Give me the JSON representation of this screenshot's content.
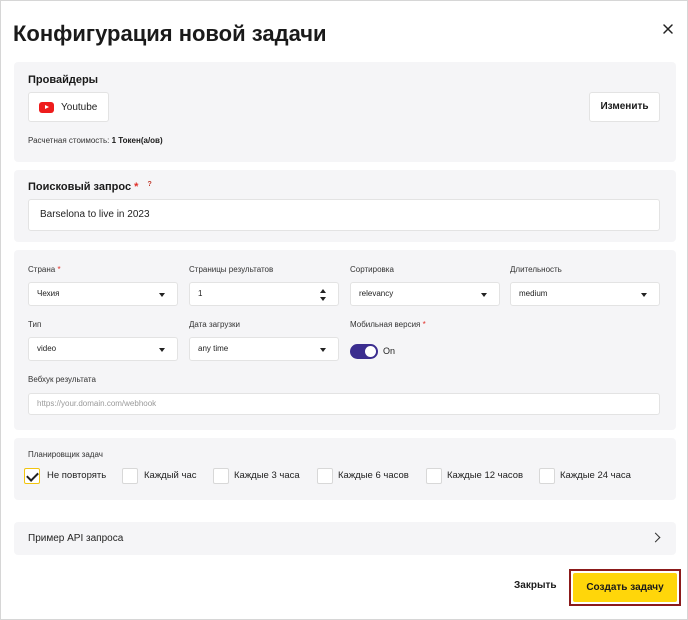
{
  "dialog": {
    "title": "Конфигурация новой задачи"
  },
  "providers": {
    "label": "Провайдеры",
    "chip": {
      "name": "Youtube",
      "icon": "youtube-icon",
      "icon_color": "#ee1c1c"
    },
    "change_label": "Изменить",
    "cost_prefix": "Расчетная стоимость:",
    "cost_value": "1 Токен(а/ов)"
  },
  "query": {
    "label": "Поисковый запрос",
    "required_mark": "*",
    "help_mark": "?",
    "value": "Barselona to live in 2023"
  },
  "params": {
    "country": {
      "label": "Страна",
      "required_mark": "*",
      "value": "Чехия"
    },
    "pages": {
      "label": "Страницы результатов",
      "value": "1"
    },
    "sort": {
      "label": "Сортировка",
      "value": "relevancy"
    },
    "duration": {
      "label": "Длительность",
      "value": "medium"
    },
    "type": {
      "label": "Тип",
      "value": "video"
    },
    "upload_date": {
      "label": "Дата загрузки",
      "value": "any time"
    },
    "mobile": {
      "label": "Мобильная версия",
      "required_mark": "*",
      "state_label": "On",
      "enabled": true,
      "accent": "#3b2d8f"
    },
    "webhook": {
      "label": "Вебхук результата",
      "placeholder": "https://your.domain.com/webhook"
    }
  },
  "scheduler": {
    "label": "Планировщик задач",
    "options": [
      {
        "label": "Не повторять",
        "checked": true
      },
      {
        "label": "Каждый час",
        "checked": false
      },
      {
        "label": "Каждые 3 часа",
        "checked": false
      },
      {
        "label": "Каждые 6 часов",
        "checked": false
      },
      {
        "label": "Каждые 12 часов",
        "checked": false
      },
      {
        "label": "Каждые 24 часа",
        "checked": false
      }
    ]
  },
  "api_example": {
    "label": "Пример API запроса"
  },
  "footer": {
    "close_label": "Закрыть",
    "create_label": "Создать задачу",
    "create_color": "#ffd60a"
  }
}
